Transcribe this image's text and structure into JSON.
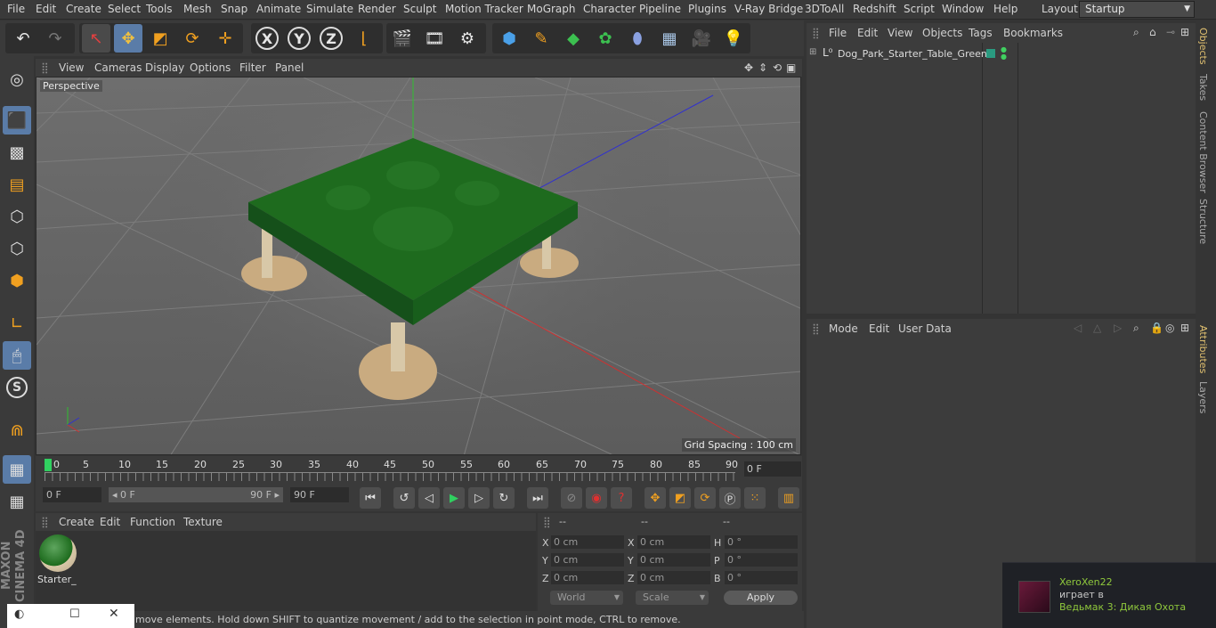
{
  "menu": [
    "File",
    "Edit",
    "Create",
    "Select",
    "Tools",
    "Mesh",
    "Snap",
    "Animate",
    "Simulate",
    "Render",
    "Sculpt",
    "Motion Tracker",
    "MoGraph",
    "Character",
    "Pipeline",
    "Plugins",
    "V-Ray Bridge",
    "3DToAll",
    "Redshift",
    "Script",
    "Window",
    "Help"
  ],
  "layout": {
    "label": "Layout:",
    "value": "Startup"
  },
  "toolbar_icons": [
    "undo-icon",
    "redo-icon",
    "select-icon",
    "move-icon",
    "scale-icon",
    "rotate-icon",
    "move-last-icon",
    "x-axis-icon",
    "y-axis-icon",
    "z-axis-icon",
    "world-coords-icon",
    "render-view-icon",
    "render-picture-viewer-icon",
    "render-settings-icon",
    "cube-icon",
    "pen-icon",
    "subdivision-icon",
    "cloner-icon",
    "deformer-icon",
    "floor-icon",
    "camera-icon",
    "light-icon"
  ],
  "viewport": {
    "menu": [
      "View",
      "Cameras",
      "Display",
      "Options",
      "Filter",
      "Panel"
    ],
    "title": "Perspective",
    "grid_spacing": "Grid Spacing : 100 cm"
  },
  "timeline": {
    "ticks": [
      "0",
      "5",
      "10",
      "15",
      "20",
      "25",
      "30",
      "35",
      "40",
      "45",
      "50",
      "55",
      "60",
      "65",
      "70",
      "75",
      "80",
      "85",
      "90"
    ],
    "current_frame": "0 F"
  },
  "transport": {
    "start": "0 F",
    "range_start": "◂ 0 F",
    "range_end": "90 F ▸",
    "end": "90 F"
  },
  "material": {
    "menu": [
      "Create",
      "Edit",
      "Function",
      "Texture"
    ],
    "name": "Starter_"
  },
  "coords": {
    "headers": [
      "--",
      "--",
      "--"
    ],
    "rows": [
      {
        "l1": "X",
        "v1": "0 cm",
        "l2": "X",
        "v2": "0 cm",
        "l3": "H",
        "v3": "0 °"
      },
      {
        "l1": "Y",
        "v1": "0 cm",
        "l2": "Y",
        "v2": "0 cm",
        "l3": "P",
        "v3": "0 °"
      },
      {
        "l1": "Z",
        "v1": "0 cm",
        "l2": "Z",
        "v2": "0 cm",
        "l3": "B",
        "v3": "0 °"
      }
    ],
    "mode": "World",
    "scale": "Scale",
    "apply": "Apply"
  },
  "status": "move elements. Hold down SHIFT to quantize movement / add to the selection in point mode, CTRL to remove.",
  "object_manager": {
    "menu": [
      "File",
      "Edit",
      "View",
      "Objects",
      "Tags",
      "Bookmarks"
    ],
    "object_name": "Dog_Park_Starter_Table_Green"
  },
  "attributes": {
    "menu": [
      "Mode",
      "Edit",
      "User Data"
    ]
  },
  "right_tabs": [
    "Objects",
    "Takes",
    "Content Browser",
    "Structure",
    "Attributes",
    "Layers"
  ],
  "notification": {
    "user": "XeroXen22",
    "action": "играет в",
    "game": "Ведьмак 3: Дикая Охота"
  },
  "logo": "MAXON CINEMA 4D"
}
